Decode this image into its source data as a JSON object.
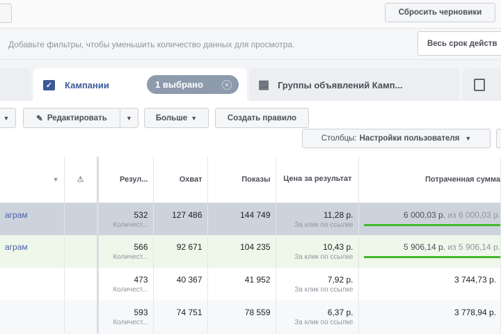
{
  "top": {
    "reset_drafts": "Сбросить черновики"
  },
  "filter": {
    "placeholder": "Добавьте фильтры, чтобы уменьшить количество данных для просмотра.",
    "date_range": "Весь срок действ"
  },
  "tabs": {
    "campaigns": "Кампании",
    "selected_pill": "1 выбрано",
    "ad_sets": "Группы объявлений Камп..."
  },
  "toolbar": {
    "edit": "Редактировать",
    "more": "Больше",
    "create_rule": "Создать правило",
    "columns_label": "Столбцы:",
    "columns_value": "Настройки пользователя"
  },
  "table": {
    "headers": {
      "results": "Резул...",
      "reach": "Охват",
      "impressions": "Показы",
      "cost": "Цена за результат",
      "spent": "Потраченная сумма"
    },
    "rows": [
      {
        "name": "аграм",
        "results": "532",
        "results_sub": "Количест...",
        "reach": "127 486",
        "impressions": "144 749",
        "cost": "11,28 р.",
        "cost_sub": "За клик по ссылке",
        "spent": "6 000,03 р.",
        "budget": "из 6 000,03 р.",
        "progress": 100
      },
      {
        "name": "аграм",
        "results": "566",
        "results_sub": "Количест...",
        "reach": "92 671",
        "impressions": "104 235",
        "cost": "10,43 р.",
        "cost_sub": "За клик по ссылке",
        "spent": "5 906,14 р.",
        "budget": "из 5 906,14 р.",
        "progress": 100
      },
      {
        "name": "",
        "results": "473",
        "results_sub": "Количест...",
        "reach": "40 367",
        "impressions": "41 952",
        "cost": "7,92 р.",
        "cost_sub": "За клик по ссылке",
        "spent": "3 744,73 р."
      },
      {
        "name": "",
        "results": "593",
        "results_sub": "Количест...",
        "reach": "74 751",
        "impressions": "78 559",
        "cost": "6,37 р.",
        "cost_sub": "За клик по ссылке",
        "spent": "3 778,94 р."
      }
    ]
  }
}
